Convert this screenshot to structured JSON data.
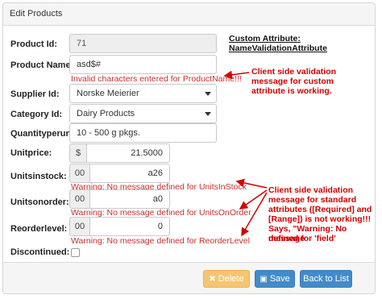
{
  "panel": {
    "title": "Edit Products"
  },
  "form": {
    "product_id": {
      "label": "Product Id:",
      "value": "71"
    },
    "product_name": {
      "label": "Product Name:",
      "value": "asd$#",
      "error": "Invalid characters entered for ProductName!!!"
    },
    "supplier_id": {
      "label": "Supplier Id:",
      "value": "Norske Meierier"
    },
    "category_id": {
      "label": "Category Id:",
      "value": "Dairy Products"
    },
    "quantity_per_unit": {
      "label": "Quantityperunit:",
      "value": "10 - 500 g pkgs."
    },
    "unit_price": {
      "label": "Unitprice:",
      "prefix": "$",
      "value": "21.5000"
    },
    "units_in_stock": {
      "label": "Unitsinstock:",
      "prefix": "00",
      "value": "a26",
      "warning": "Warning: No message defined for UnitsInStock"
    },
    "units_on_order": {
      "label": "Unitsonorder:",
      "prefix": "00",
      "value": "a0",
      "warning": "Warning: No message defined for UnitsOnOrder"
    },
    "reorder_level": {
      "label": "Reorderlevel:",
      "prefix": "00",
      "value": "0",
      "warning": "Warning: No message defined for ReorderLevel"
    },
    "discontinued": {
      "label": "Discontinued:",
      "checked": false
    }
  },
  "annotations": {
    "custom_attr_line1": "Custom Attribute:",
    "custom_attr_line2": "NameValidationAttribute",
    "custom_note_1": "Client side validation",
    "custom_note_2": "message for custom",
    "custom_note_3": "attribute is working.",
    "std_note_1": "Client side validation",
    "std_note_2": "message for standard",
    "std_note_3": "attributes ([Required] and",
    "std_note_4": "[Range]) is not working!!!",
    "std_note_5": "Says, \"Warning: No message",
    "std_note_6": "defined for 'field'"
  },
  "buttons": {
    "delete": {
      "label": "Delete",
      "icon": "x-icon"
    },
    "save": {
      "label": "Save",
      "icon": "floppy-disk-icon"
    },
    "back": {
      "label": "Back to List"
    }
  },
  "colors": {
    "error_text": "#c9302c",
    "annotation_red": "#d00000",
    "primary_button": "#428bca",
    "warning_button": "#f7c571"
  }
}
